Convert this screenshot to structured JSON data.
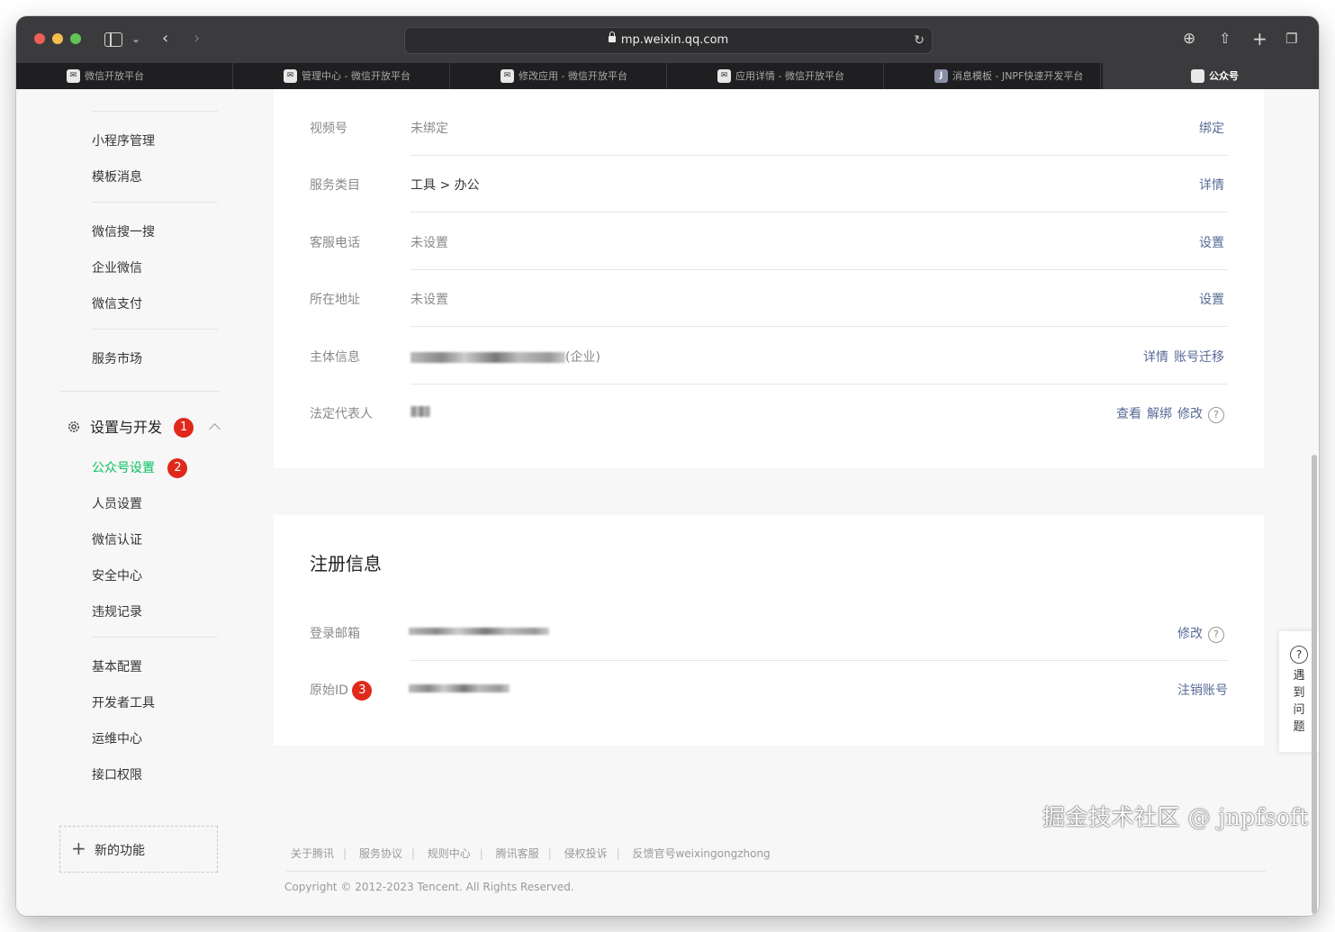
{
  "browser": {
    "url": "mp.weixin.qq.com",
    "tabs": [
      {
        "title": "微信开放平台"
      },
      {
        "title": "管理中心 - 微信开放平台"
      },
      {
        "title": "修改应用 - 微信开放平台"
      },
      {
        "title": "应用详情 - 微信开放平台"
      },
      {
        "title": "消息模板 - JNPF快速开发平台",
        "favicon_letter": "J"
      }
    ],
    "active_tab": "公众号"
  },
  "sidebar": {
    "group1": [
      "小程序管理",
      "模板消息"
    ],
    "group2": [
      "微信搜一搜",
      "企业微信",
      "微信支付"
    ],
    "group3": [
      "服务市场"
    ],
    "section_title": "设置与开发",
    "section_badge": "1",
    "section_items": [
      {
        "label": "公众号设置",
        "active": true,
        "badge": "2"
      },
      {
        "label": "人员设置"
      },
      {
        "label": "微信认证"
      },
      {
        "label": "安全中心"
      },
      {
        "label": "违规记录"
      }
    ],
    "group4": [
      "基本配置",
      "开发者工具",
      "运维中心",
      "接口权限"
    ],
    "new_func": "新的功能"
  },
  "account_info": {
    "rows": [
      {
        "label": "视频号",
        "value": "未绑定",
        "actions": [
          "绑定"
        ]
      },
      {
        "label": "服务类目",
        "value": "工具 > 办公",
        "actions": [
          "详情"
        ]
      },
      {
        "label": "客服电话",
        "value": "未设置",
        "actions": [
          "设置"
        ]
      },
      {
        "label": "所在地址",
        "value": "未设置",
        "actions": [
          "设置"
        ]
      },
      {
        "label": "主体信息",
        "value_suffix": "(企业)",
        "actions": [
          "详情",
          "账号迁移"
        ]
      },
      {
        "label": "法定代表人",
        "actions": [
          "查看",
          "解绑",
          "修改"
        ]
      }
    ]
  },
  "registration": {
    "title": "注册信息",
    "email_label": "登录邮箱",
    "email_action": "修改",
    "id_label": "原始ID",
    "id_badge": "3",
    "id_action": "注销账号"
  },
  "footer": {
    "links": [
      "关于腾讯",
      "服务协议",
      "规则中心",
      "腾讯客服",
      "侵权投诉",
      "反馈官号weixingongzhong"
    ],
    "copyright": "Copyright © 2012-2023 Tencent. All Rights Reserved."
  },
  "help_float": {
    "chars": [
      "遇",
      "到",
      "问",
      "题"
    ]
  },
  "watermark": "掘金技术社区 @ jnpfsoft",
  "colors": {
    "accent_green": "#07c160",
    "link_blue": "#576b95",
    "badge_red": "#e0281b"
  }
}
